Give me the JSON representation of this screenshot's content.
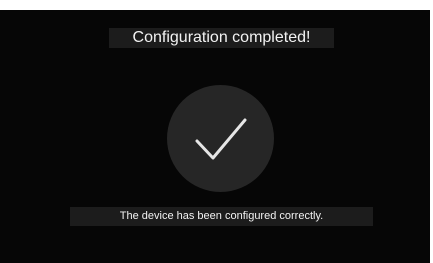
{
  "dialog": {
    "title": "Configuration completed!",
    "status_icon": "checkmark-icon",
    "message": "The device has been configured correctly."
  },
  "colors": {
    "background": "#060606",
    "panel": "#1c1c1c",
    "circle": "#262626",
    "text": "#f2f2f2",
    "check": "#e6e6e6"
  }
}
